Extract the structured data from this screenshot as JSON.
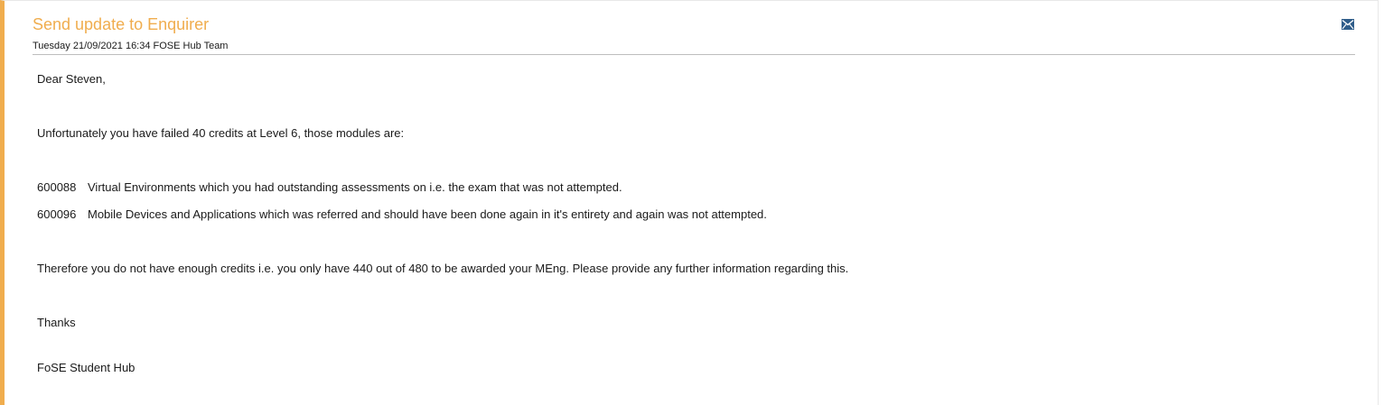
{
  "message": {
    "title": "Send update to Enquirer",
    "meta": "Tuesday 21/09/2021 16:34 FOSE Hub Team",
    "icon": "mail-icon",
    "accent_color": "#f0ad4e"
  },
  "email": {
    "greeting": "Dear Steven,",
    "intro": "Unfortunately you have failed 40 credits at Level 6, those modules are:",
    "modules": [
      {
        "code": "600088",
        "text": "Virtual Environments which you had outstanding assessments on i.e. the exam that was not attempted."
      },
      {
        "code": "600096",
        "text": "Mobile Devices and Applications which was referred and should have been done again in it's entirety and again was not attempted."
      }
    ],
    "summary": "Therefore you do not have enough credits i.e. you only have 440 out of 480 to be awarded your MEng. Please provide any further information regarding this.",
    "sign_off": "Thanks",
    "signature": "FoSE Student Hub"
  }
}
